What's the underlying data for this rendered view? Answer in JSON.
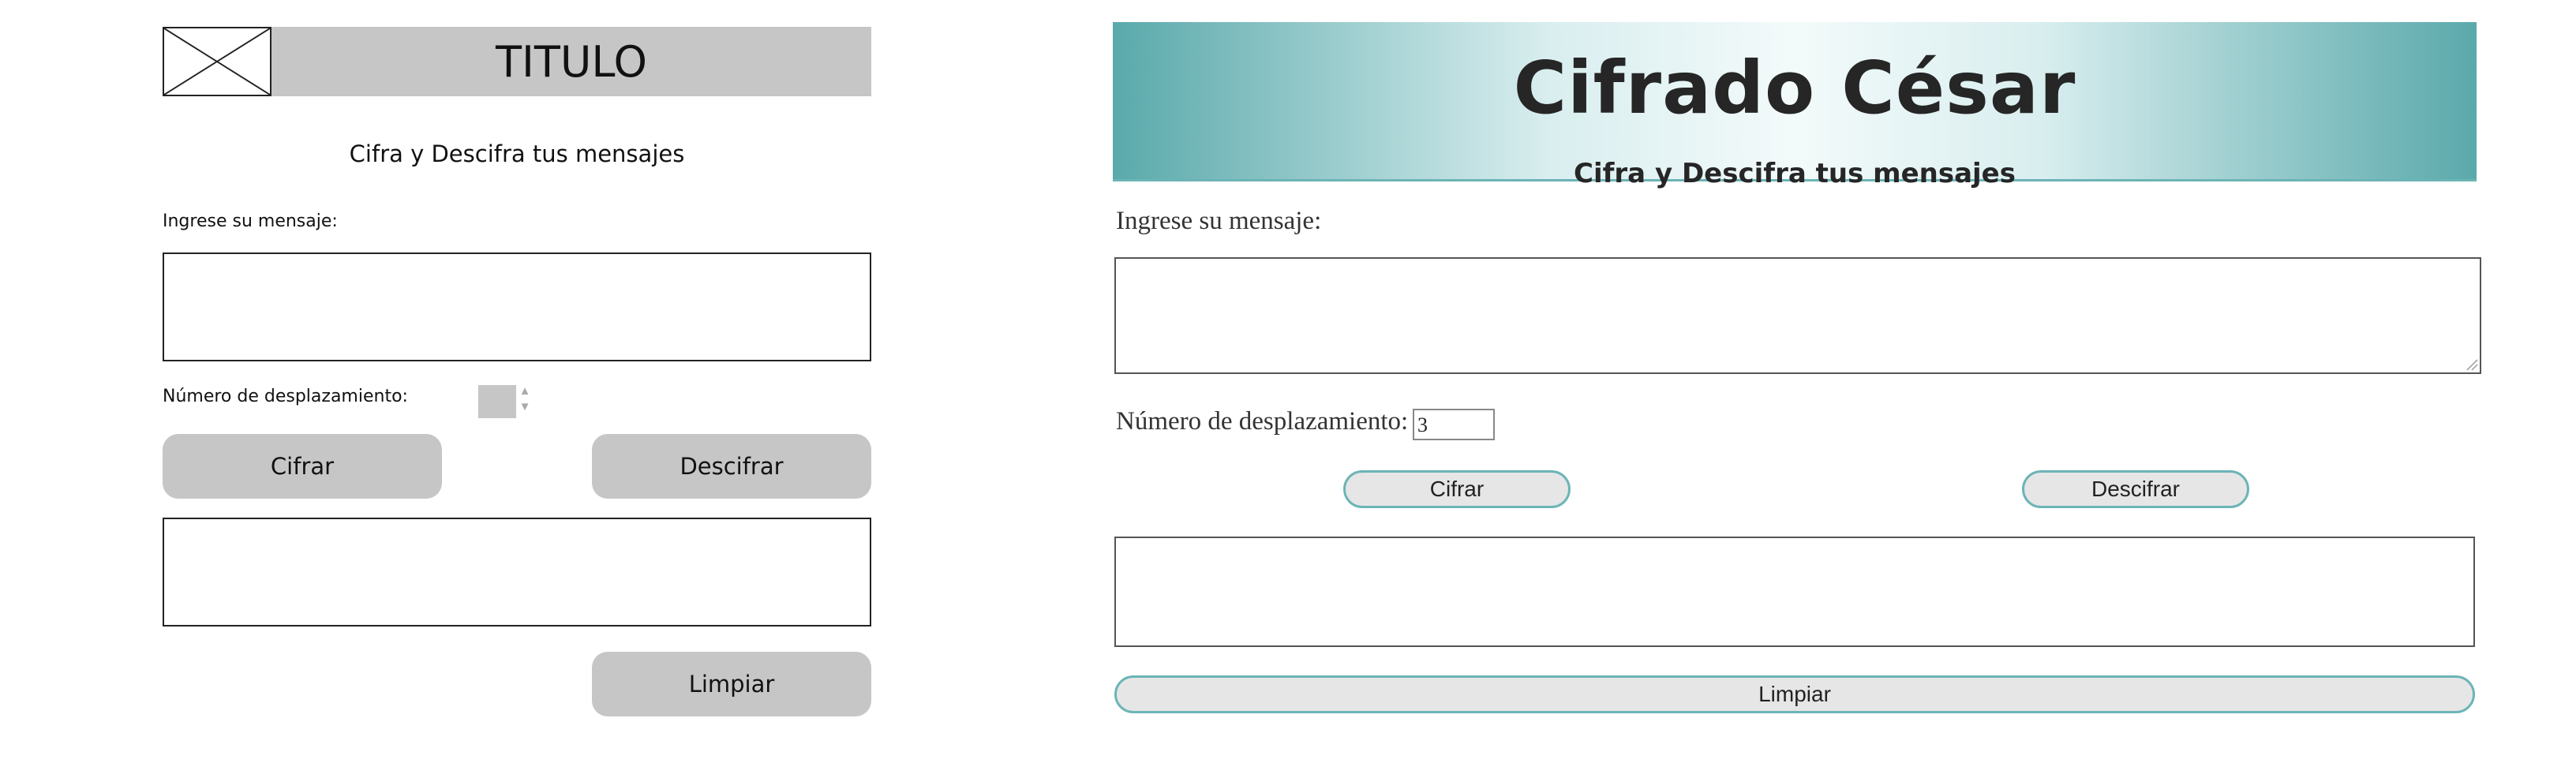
{
  "wireframe": {
    "title": "TITULO",
    "subtitle": "Cifra y Descifra tus mensajes",
    "message_label": "Ingrese su mensaje:",
    "shift_label": "Número de desplazamiento:",
    "encrypt_button": "Cifrar",
    "decrypt_button": "Descifrar",
    "clear_button": "Limpiar"
  },
  "rendered": {
    "title": "Cifrado César",
    "subtitle": "Cifra y Descifra tus mensajes",
    "message_label": "Ingrese su mensaje:",
    "message_value": "",
    "shift_label": "Número de desplazamiento:",
    "shift_value": "3",
    "encrypt_button": "Cifrar",
    "decrypt_button": "Descifrar",
    "output_value": "",
    "clear_button": "Limpiar"
  },
  "colors": {
    "header_teal": "#5aa9ab",
    "button_border": "#6cb4b6",
    "wireframe_gray": "#c6c6c6"
  }
}
